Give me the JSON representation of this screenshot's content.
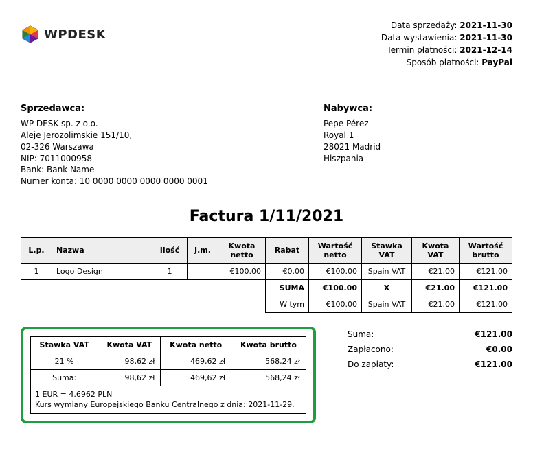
{
  "meta": {
    "saleDateLabel": "Data sprzedaży:",
    "saleDate": "2021-11-30",
    "issueDateLabel": "Data wystawienia:",
    "issueDate": "2021-11-30",
    "dueDateLabel": "Termin płatności:",
    "dueDate": "2021-12-14",
    "paymentMethodLabel": "Sposób płatności:",
    "paymentMethod": "PayPal"
  },
  "logo": {
    "text": "WPDESK"
  },
  "seller": {
    "heading": "Sprzedawca:",
    "name": "WP DESK sp. z o.o.",
    "address1": "Aleje Jerozolimskie 151/10,",
    "address2": "02-326 Warszawa",
    "nip": "NIP: 7011000958",
    "bank": "Bank: Bank Name",
    "account": "Numer konta: 10 0000 0000 0000 0000 0001"
  },
  "buyer": {
    "heading": "Nabywca:",
    "name": "Pepe Pérez",
    "address1": "Royal 1",
    "address2": "28021 Madrid",
    "country": "Hiszpania"
  },
  "title": "Factura 1/11/2021",
  "itemsHeader": {
    "lp": "L.p.",
    "name": "Nazwa",
    "qty": "Ilość",
    "unit": "J.m.",
    "net": "Kwota netto",
    "discount": "Rabat",
    "netValue": "Wartość netto",
    "vatRate": "Stawka VAT",
    "vat": "Kwota VAT",
    "gross": "Wartość brutto"
  },
  "items": [
    {
      "lp": "1",
      "name": "Logo Design",
      "qty": "1",
      "unit": "",
      "net": "€100.00",
      "discount": "€0.00",
      "netValue": "€100.00",
      "vatRate": "Spain VAT",
      "vat": "€21.00",
      "gross": "€121.00"
    }
  ],
  "sumRow": {
    "label": "SUMA",
    "netValue": "€100.00",
    "vatRate": "X",
    "vat": "€21.00",
    "gross": "€121.00"
  },
  "inclRow": {
    "label": "W tym",
    "netValue": "€100.00",
    "vatRate": "Spain VAT",
    "vat": "€21.00",
    "gross": "€121.00"
  },
  "vatTable": {
    "headers": {
      "rate": "Stawka VAT",
      "vat": "Kwota VAT",
      "net": "Kwota netto",
      "gross": "Kwota brutto"
    },
    "rows": [
      {
        "rate": "21 %",
        "vat": "98,62 zł",
        "net": "469,62 zł",
        "gross": "568,24 zł"
      },
      {
        "rate": "Suma:",
        "vat": "98,62 zł",
        "net": "469,62 zł",
        "gross": "568,24 zł"
      }
    ],
    "note1": "1 EUR = 4.6962 PLN",
    "note2": "Kurs wymiany Europejskiego Banku Centralnego z dnia: 2021-11-29."
  },
  "totals": {
    "sumLabel": "Suma:",
    "sum": "€121.00",
    "paidLabel": "Zapłacono:",
    "paid": "€0.00",
    "dueLabel": "Do zapłaty:",
    "due": "€121.00"
  }
}
